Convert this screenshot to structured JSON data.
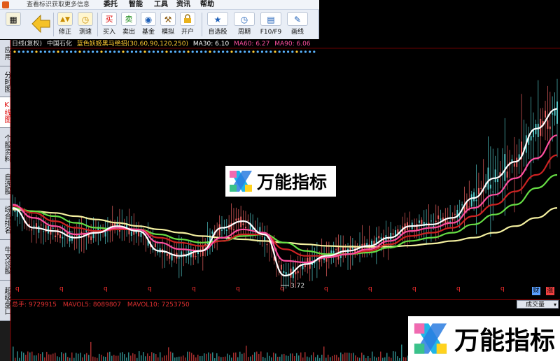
{
  "window": {
    "message": "查看标识获取更多信息",
    "menus": [
      "委托",
      "智能",
      "工具",
      "资讯",
      "帮助"
    ]
  },
  "toolbar": {
    "buttons": [
      {
        "id": "fix",
        "label": "修正",
        "glyph": "▲▼"
      },
      {
        "id": "test",
        "label": "测速",
        "glyph": "◷"
      },
      {
        "id": "buy",
        "label": "买入",
        "glyph": "买"
      },
      {
        "id": "sell",
        "label": "卖出",
        "glyph": "卖"
      },
      {
        "id": "fund",
        "label": "基金",
        "glyph": "◉"
      },
      {
        "id": "simulate",
        "label": "模拟",
        "glyph": "⚒"
      },
      {
        "id": "open-account",
        "label": "开户",
        "glyph": "🔒"
      },
      {
        "id": "watchlist",
        "label": "自选股",
        "glyph": "★"
      },
      {
        "id": "period",
        "label": "周期",
        "glyph": "◷"
      },
      {
        "id": "f10",
        "label": "F10/F9",
        "glyph": "▤"
      },
      {
        "id": "draw",
        "label": "画线",
        "glyph": "✎"
      }
    ]
  },
  "left_tabs": [
    {
      "label": "应用",
      "active": false
    },
    {
      "label": "分时图",
      "active": false
    },
    {
      "label": "K线图",
      "active": true
    },
    {
      "label": "个股资料",
      "active": false
    },
    {
      "label": "自选股",
      "active": false
    },
    {
      "label": "综合排名",
      "active": false
    },
    {
      "label": "牛叉诊股",
      "active": false
    },
    {
      "label": "超级盘口",
      "active": false
    }
  ],
  "chart_header": {
    "period": "日线(复权)",
    "stock": "中国石化",
    "indicator": "蓝色妖姬黑马绝招(30,60,90,120,250)",
    "ma30": "MA30: 6.10",
    "ma60": "MA60: 6.27",
    "ma90": "MA90: 6.06"
  },
  "colors": {
    "ma30": "#ffffff",
    "ma60": "#ff4fa0",
    "ma90": "#cc2222",
    "ma120": "#66dd44",
    "ma250": "#f4f0a0",
    "candle": "#ff6a6a",
    "marker": "#ff3030"
  },
  "chart_data": {
    "type": "line",
    "annotations": [
      "3.72"
    ],
    "markers": [
      "q",
      "q",
      "q",
      "q",
      "q",
      "q",
      "q",
      "q",
      "q",
      "q",
      "q",
      "q"
    ],
    "badges": [
      "财",
      "涨"
    ],
    "series": [
      {
        "key": "ma30",
        "values": [
          6.0,
          5.4,
          5.3,
          5.1,
          5.25,
          5.45,
          5.3,
          4.7,
          4.55,
          4.7,
          5.4,
          5.6,
          5.2,
          3.95,
          4.3,
          4.55,
          4.7,
          4.85,
          5.1,
          5.45,
          5.5,
          5.7,
          6.3,
          6.9,
          7.4,
          8.4,
          9.0
        ]
      },
      {
        "key": "ma60",
        "values": [
          6.1,
          5.7,
          5.45,
          5.2,
          5.25,
          5.4,
          5.35,
          4.95,
          4.75,
          4.7,
          5.1,
          5.35,
          5.25,
          4.4,
          4.35,
          4.5,
          4.6,
          4.75,
          5.0,
          5.3,
          5.4,
          5.55,
          6.0,
          6.4,
          6.9,
          7.5,
          8.2
        ]
      },
      {
        "key": "ma90",
        "values": [
          6.06,
          5.85,
          5.6,
          5.4,
          5.3,
          5.35,
          5.35,
          5.1,
          4.95,
          4.85,
          5.0,
          5.2,
          5.2,
          4.75,
          4.55,
          4.55,
          4.6,
          4.7,
          4.9,
          5.15,
          5.25,
          5.4,
          5.75,
          6.1,
          6.5,
          7.0,
          7.6
        ]
      },
      {
        "key": "ma120",
        "values": [
          6.0,
          5.9,
          5.75,
          5.55,
          5.4,
          5.35,
          5.35,
          5.2,
          5.05,
          4.95,
          5.0,
          5.15,
          5.2,
          4.95,
          4.7,
          4.6,
          4.6,
          4.65,
          4.8,
          5.0,
          5.1,
          5.25,
          5.5,
          5.8,
          6.1,
          6.6,
          7.0
        ]
      },
      {
        "key": "ma250",
        "values": [
          5.95,
          5.9,
          5.85,
          5.75,
          5.65,
          5.55,
          5.45,
          5.35,
          5.25,
          5.15,
          5.1,
          5.05,
          5.0,
          4.95,
          4.9,
          4.85,
          4.83,
          4.82,
          4.83,
          4.86,
          4.92,
          5.0,
          5.1,
          5.25,
          5.45,
          5.7,
          6.0
        ]
      }
    ]
  },
  "volume": {
    "total": "总手: 9729915",
    "mavol5": "MAVOL5: 8089807",
    "mavol10": "MAVOL10: 7253750",
    "selector": "成交量"
  },
  "watermark": {
    "text": "万能指标"
  }
}
